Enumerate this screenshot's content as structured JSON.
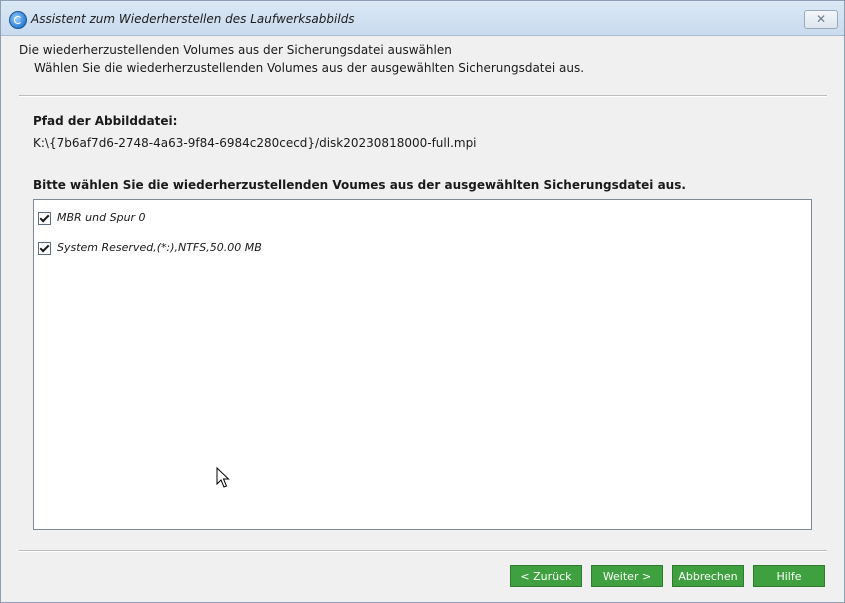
{
  "window": {
    "title": "Assistent zum Wiederherstellen des Laufwerksabbilds",
    "icon": "app-restore-icon",
    "close_glyph": "✕"
  },
  "header": {
    "title": "Die wiederherzustellenden Volumes aus der Sicherungsdatei auswählen",
    "subtitle": "Wählen Sie die wiederherzustellenden Volumes aus der ausgewählten Sicherungsdatei aus."
  },
  "image_path": {
    "label": "Pfad der Abbilddatei:",
    "value": "K:\\{7b6af7d6-2748-4a63-9f84-6984c280cecd}/disk20230818000-full.mpi"
  },
  "volumes": {
    "label": "Bitte wählen Sie die wiederherzustellenden Voumes aus der ausgewählten Sicherungsdatei aus.",
    "items": [
      {
        "label": "MBR und Spur 0",
        "checked": true
      },
      {
        "label": "System Reserved,(*:),NTFS,50.00 MB",
        "checked": true
      }
    ]
  },
  "buttons": {
    "back": "< Zurück",
    "next": "Weiter >",
    "cancel": "Abbrechen",
    "help": "Hilfe"
  },
  "colors": {
    "button_green": "#3fa03f",
    "titlebar": "#d4e3f2"
  }
}
